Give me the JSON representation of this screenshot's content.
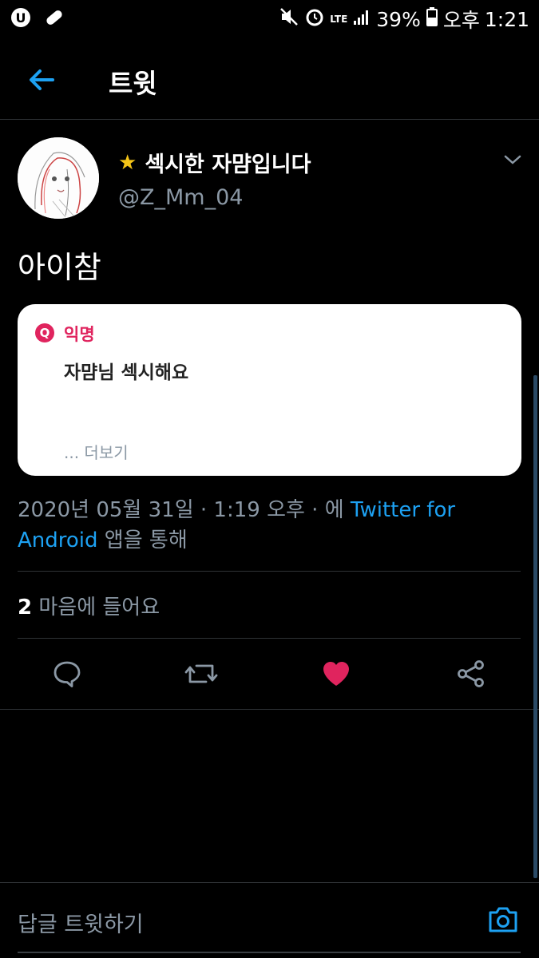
{
  "status_bar": {
    "battery": "39%",
    "ampm": "오후",
    "time": "1:21",
    "network": "LTE"
  },
  "header": {
    "title": "트윗"
  },
  "tweet": {
    "display_name": "섹시한 자먐입니다",
    "handle": "@Z_Mm_04",
    "text": "아이참",
    "card": {
      "badge": "Q",
      "label": "익명",
      "question": "자먐님 섹시해요",
      "more": "... 더보기"
    },
    "meta": {
      "datetime": "2020년 05월 31일 · 1:19 오후 · 에",
      "source_part1": "Twitter for",
      "source_part2": "Android",
      "suffix": "앱을 통해"
    },
    "likes": {
      "count": "2",
      "label": "마음에 들어요"
    }
  },
  "reply": {
    "placeholder": "답글 트윗하기"
  },
  "colors": {
    "accent": "#1da1f2",
    "like": "#e0245e",
    "muted": "#8b98a5"
  }
}
